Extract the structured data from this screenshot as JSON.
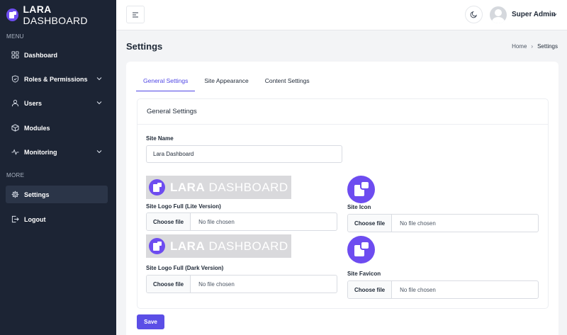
{
  "brand": {
    "bold": "LARA",
    "light": " DASHBOARD"
  },
  "sidebar": {
    "menu_heading": "MENU",
    "more_heading": "MORE",
    "items": [
      {
        "label": "Dashboard",
        "icon": "grid-icon"
      },
      {
        "label": "Roles & Permissions",
        "icon": "shield-icon"
      },
      {
        "label": "Users",
        "icon": "user-icon"
      },
      {
        "label": "Modules",
        "icon": "cube-icon"
      },
      {
        "label": "Monitoring",
        "icon": "activity-icon"
      }
    ],
    "more_items": [
      {
        "label": "Settings",
        "icon": "gear-icon",
        "active": true
      },
      {
        "label": "Logout",
        "icon": "logout-icon"
      }
    ]
  },
  "topbar": {
    "user_name": "Super Admin"
  },
  "page": {
    "title": "Settings",
    "breadcrumb": {
      "home": "Home",
      "current": "Settings"
    }
  },
  "tabs": [
    {
      "label": "General Settings",
      "active": true
    },
    {
      "label": "Site Appearance"
    },
    {
      "label": "Content Settings"
    }
  ],
  "form": {
    "heading": "General Settings",
    "site_name_label": "Site Name",
    "site_name_value": "Lara Dashboard",
    "logo_lite_label": "Site Logo Full (Lite Version)",
    "logo_dark_label": "Site Logo Full (Dark Version)",
    "site_icon_label": "Site Icon",
    "site_favicon_label": "Site Favicon",
    "choose_file": "Choose file",
    "no_file": "No file chosen",
    "logo_word_bold": "LARA",
    "logo_word_light": " DASHBOARD",
    "save": "Save"
  },
  "colors": {
    "accent": "#5b4ee6",
    "sidebar_bg": "#1c2434",
    "logo_purple": "#6d4cf0"
  }
}
